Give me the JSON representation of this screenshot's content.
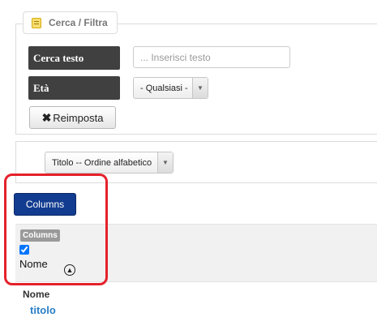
{
  "filter": {
    "legend": "Cerca / Filtra",
    "legend_icon": "notepad-icon",
    "search_label": "Cerca testo",
    "search_placeholder": "... Inserisci testo",
    "search_value": "",
    "age_label": "Età",
    "age_selected": "- Qualsiasi -",
    "reset_icon": "close-icon",
    "reset_label": "Reimposta"
  },
  "sort": {
    "selected": "Titolo -- Ordine alfabetico"
  },
  "columns": {
    "button_label": "Columns",
    "badge_label": "Columns",
    "items": [
      {
        "label": "Nome",
        "checked": true,
        "icon": "sort-up-circle-icon"
      }
    ]
  },
  "table": {
    "header": "Nome",
    "rows": [
      {
        "title": "titolo"
      }
    ]
  },
  "colors": {
    "label_bg": "#404040",
    "primary_button": "#123c8f",
    "link": "#2a7fc6",
    "highlight": "#e5212b"
  }
}
